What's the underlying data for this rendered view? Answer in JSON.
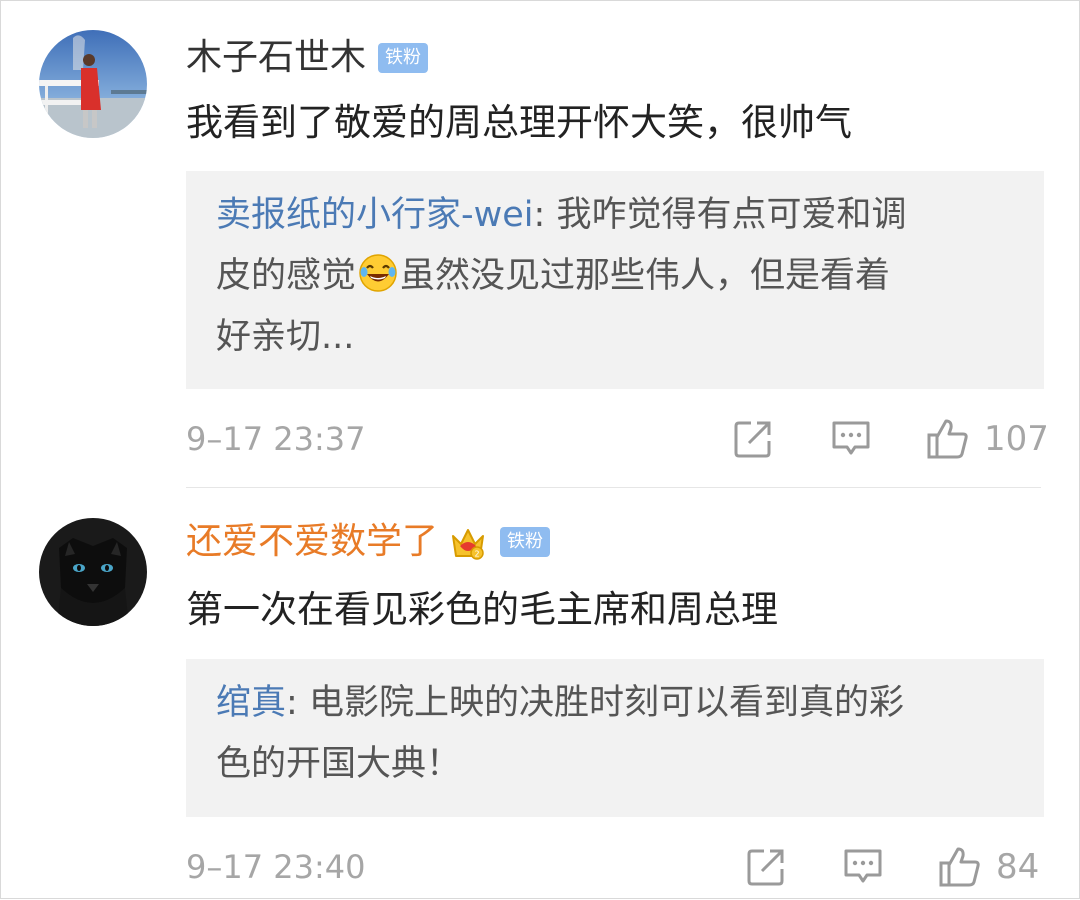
{
  "comments": [
    {
      "username": "木子石世木",
      "badge": "铁粉",
      "text": "我看到了敬爱的周总理开怀大笑，很帅气",
      "reply": {
        "author": "卖报纸的小行家-wei",
        "separator": ": ",
        "line1": "我咋觉得有点可爱和调",
        "line2_a": "皮的感觉",
        "emoji_icon": "laughing-tears-icon",
        "line2_b": "虽然没见过那些伟人，但是看着",
        "line3": "好亲切..."
      },
      "time": "9–17 23:37",
      "likes": "107",
      "username_color": "#333333"
    },
    {
      "username": "还爱不爱数学了",
      "badge": "铁粉",
      "crown_icon": "vip-crown-icon",
      "text": "第一次在看见彩色的毛主席和周总理",
      "reply": {
        "author": "绾真",
        "separator": ": ",
        "line1": "电影院上映的决胜时刻可以看到真的彩",
        "line2": "色的开国大典！"
      },
      "time": "9–17 23:40",
      "likes": "84",
      "username_color": "#e87b27"
    }
  ],
  "colors": {
    "reply_author": "#4b7ab5",
    "badge_bg": "#8fbcf0",
    "meta_gray": "#a6a6a6"
  },
  "icons": [
    "share-icon",
    "comment-icon",
    "like-thumb-icon"
  ]
}
